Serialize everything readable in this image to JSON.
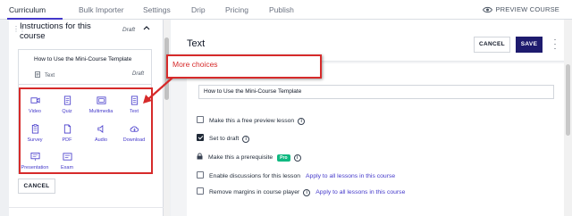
{
  "nav": {
    "tabs": [
      "Curriculum",
      "Bulk Importer",
      "Settings",
      "Drip",
      "Pricing",
      "Publish"
    ],
    "active": "Curriculum",
    "preview_label": "PREVIEW COURSE"
  },
  "sidebar": {
    "section_title": "Instructions for this course",
    "section_status": "Draft",
    "lesson": {
      "title": "How to Use the Mini-Course Template",
      "type": "Text",
      "status": "Draft"
    },
    "choices": [
      {
        "label": "Video",
        "icon": "video-icon"
      },
      {
        "label": "Quiz",
        "icon": "quiz-icon"
      },
      {
        "label": "Multimedia",
        "icon": "multimedia-icon"
      },
      {
        "label": "Text",
        "icon": "text-icon"
      },
      {
        "label": "Survey",
        "icon": "survey-icon"
      },
      {
        "label": "PDF",
        "icon": "pdf-icon"
      },
      {
        "label": "Audio",
        "icon": "audio-icon"
      },
      {
        "label": "Download",
        "icon": "download-icon"
      },
      {
        "label": "Presentation",
        "icon": "presentation-icon"
      },
      {
        "label": "Exam",
        "icon": "exam-icon"
      }
    ],
    "cancel_label": "CANCEL"
  },
  "annotation": {
    "callout_text": "More choices",
    "color": "#d62a2a"
  },
  "editor": {
    "title": "Text",
    "cancel_label": "CANCEL",
    "save_label": "SAVE",
    "lesson_title_value": "How to Use the Mini-Course Template",
    "options": {
      "free_preview": {
        "label": "Make this a free preview lesson",
        "checked": false
      },
      "set_draft": {
        "label": "Set to draft",
        "checked": true
      },
      "prerequisite": {
        "label": "Make this a prerequisite",
        "badge": "Pro"
      },
      "discussions": {
        "label": "Enable discussions for this lesson",
        "link": "Apply to all lessons in this course",
        "checked": false
      },
      "margins": {
        "label": "Remove margins in course player",
        "link": "Apply to all lessons in this course",
        "checked": false
      }
    }
  },
  "colors": {
    "accent": "#4338ca",
    "save_button": "#1e1b6e",
    "pro_badge": "#10b981"
  }
}
